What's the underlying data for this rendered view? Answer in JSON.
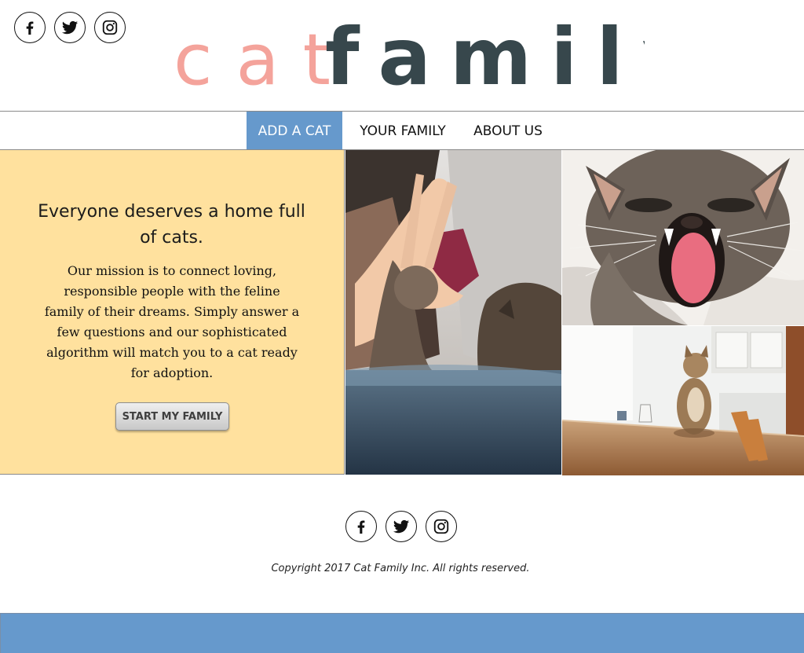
{
  "logo": {
    "part1": "cat",
    "part2": "family",
    "color_part1": "#f4a39b",
    "color_part2": "#37474c"
  },
  "social_icons": [
    "facebook-icon",
    "twitter-icon",
    "instagram-icon"
  ],
  "nav": {
    "items": [
      "ADD A CAT",
      "YOUR FAMILY",
      "ABOUT US"
    ],
    "active_index": 0,
    "active_color": "#6699cc"
  },
  "hero": {
    "title": "Everyone deserves a home full of cats.",
    "body": "Our mission is to connect loving, responsible people with the feline family of their dreams. Simply answer a few questions and our sophisticated algorithm will match you to a cat ready for adoption.",
    "button_label": "START MY FAMILY",
    "background_color": "#ffe19e"
  },
  "photos": [
    "person high-fiving a cat",
    "yawning tabby cat",
    "cat sitting on a kitchen table"
  ],
  "footer": {
    "copyright": "Copyright 2017 Cat Family Inc. All rights reserved.",
    "bar_color": "#6699cc"
  }
}
